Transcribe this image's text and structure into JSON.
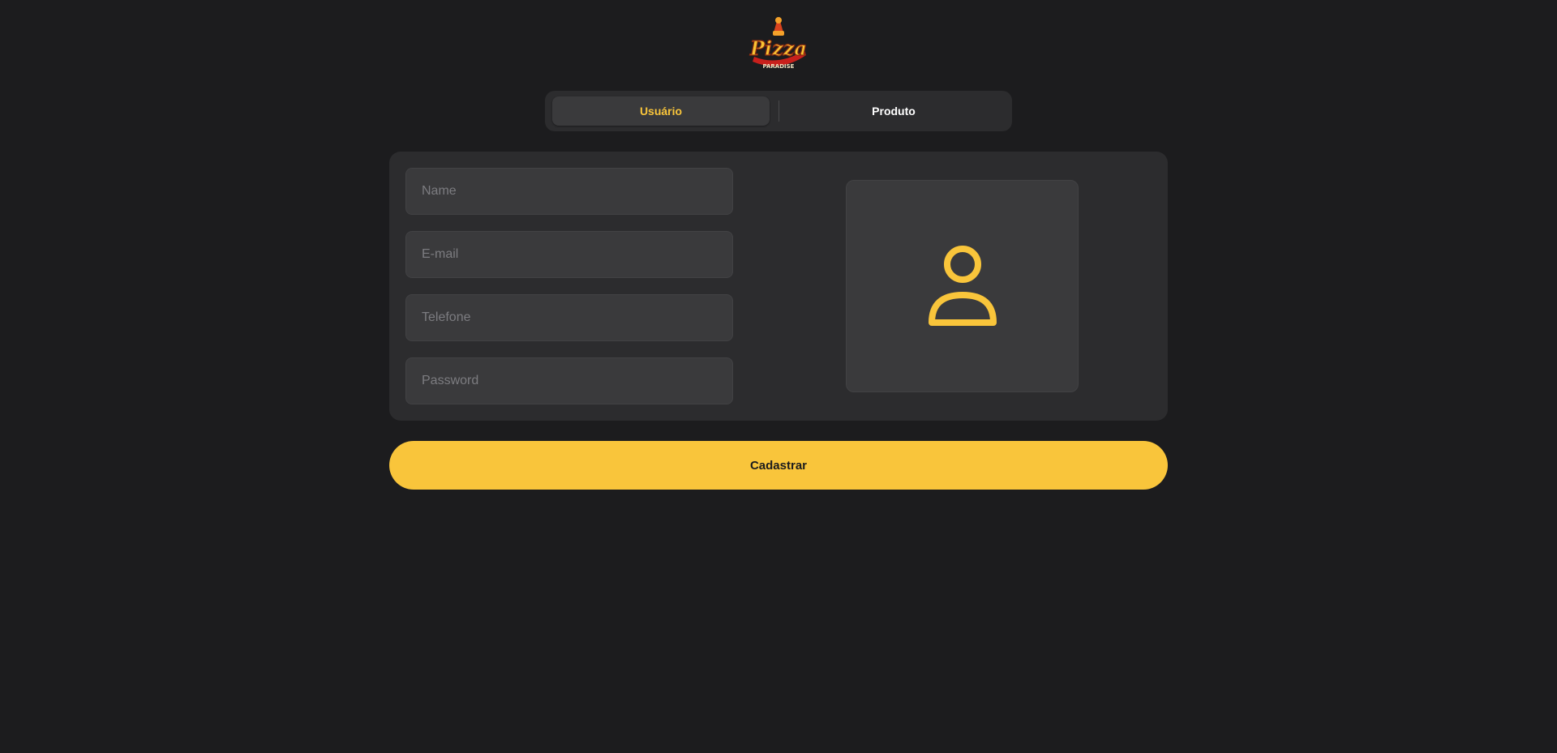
{
  "logo": {
    "text_top": "Pizza",
    "text_bottom": "PARADISE",
    "icon": "pizza-logo"
  },
  "tabs": [
    {
      "label": "Usuário",
      "active": true
    },
    {
      "label": "Produto",
      "active": false
    }
  ],
  "form": {
    "name_placeholder": "Name",
    "email_placeholder": "E-mail",
    "phone_placeholder": "Telefone",
    "password_placeholder": "Password",
    "avatar_icon": "user-icon"
  },
  "submit_label": "Cadastrar",
  "colors": {
    "accent": "#f9c53b",
    "background": "#1c1c1e",
    "card": "#2c2c2e",
    "input": "#3a3a3c"
  }
}
